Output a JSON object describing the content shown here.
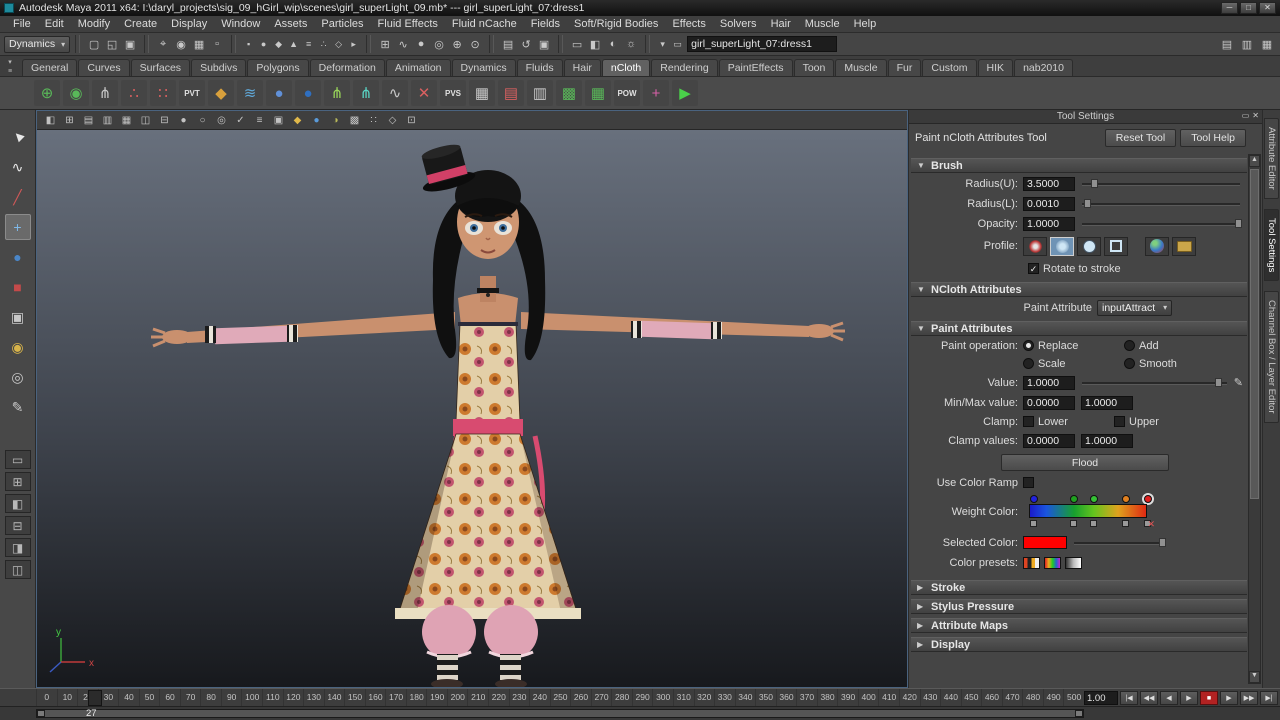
{
  "window": {
    "title": "Autodesk Maya 2011 x64: I:\\daryl_projects\\sig_09_hGirl_wip\\scenes\\girl_superLight_09.mb*  ---  girl_superLight_07:dress1",
    "minimize": "─",
    "maximize": "□",
    "close": "✕"
  },
  "menu_bar": {
    "items": [
      "File",
      "Edit",
      "Modify",
      "Create",
      "Display",
      "Window",
      "Assets",
      "Particles",
      "Fluid Effects",
      "Fluid nCache",
      "Fields",
      "Soft/Rigid Bodies",
      "Effects",
      "Solvers",
      "Hair",
      "Muscle",
      "Help"
    ]
  },
  "status_line": {
    "menu_set": "Dynamics",
    "name_field": "girl_superLight_07:dress1",
    "file_icons": [
      {
        "glyph": "▢",
        "name": "new-scene-icon"
      },
      {
        "glyph": "◱",
        "name": "open-scene-icon"
      },
      {
        "glyph": "▣",
        "name": "save-scene-icon"
      }
    ],
    "select_mode_icons": [
      {
        "glyph": "⌖",
        "name": "select-by-hierarchy-icon"
      },
      {
        "glyph": "◉",
        "name": "select-by-object-icon"
      },
      {
        "glyph": "▦",
        "name": "select-by-component-icon"
      },
      {
        "glyph": "▫",
        "name": "highlight-selection-icon"
      }
    ],
    "mask_icons": [
      {
        "glyph": "▪",
        "name": "selection-mask-icon"
      },
      {
        "glyph": "●",
        "name": "selection-mask-icon"
      },
      {
        "glyph": "◆",
        "name": "selection-mask-icon"
      },
      {
        "glyph": "▲",
        "name": "selection-mask-icon"
      },
      {
        "glyph": "≡",
        "name": "selection-mask-icon"
      },
      {
        "glyph": "∴",
        "name": "selection-mask-icon"
      },
      {
        "glyph": "◇",
        "name": "selection-mask-icon"
      },
      {
        "glyph": "▸",
        "name": "selection-mask-icon"
      }
    ],
    "snap_icons": [
      {
        "glyph": "⊞",
        "name": "snap-to-grid-icon"
      },
      {
        "glyph": "∿",
        "name": "snap-to-curve-icon"
      },
      {
        "glyph": "●",
        "name": "snap-to-point-icon"
      },
      {
        "glyph": "◎",
        "name": "snap-to-projected-center-icon"
      },
      {
        "glyph": "⊕",
        "name": "snap-to-view-plane-icon"
      },
      {
        "glyph": "⊙",
        "name": "make-object-live-icon"
      }
    ],
    "history_icons": [
      {
        "glyph": "▤",
        "name": "input-connections-icon"
      },
      {
        "glyph": "↺",
        "name": "construction-history-icon"
      },
      {
        "glyph": "▣",
        "name": "output-connections-icon"
      }
    ],
    "render_icons": [
      {
        "glyph": "▭",
        "name": "open-render-view-icon"
      },
      {
        "glyph": "◧",
        "name": "render-current-frame-icon"
      },
      {
        "glyph": "◐",
        "name": "ipr-render-icon"
      },
      {
        "glyph": "☼",
        "name": "render-settings-icon"
      }
    ],
    "field_icons": [
      {
        "glyph": "▾",
        "name": "input-line-mode-icon"
      },
      {
        "glyph": "▭",
        "name": "numeric-input-icon"
      }
    ],
    "right_icons": [
      {
        "glyph": "▤",
        "name": "show-attribute-editor-icon"
      },
      {
        "glyph": "▥",
        "name": "show-tool-settings-icon"
      },
      {
        "glyph": "▦",
        "name": "show-channel-box-icon"
      }
    ]
  },
  "shelf": {
    "menu_arrow": "▾",
    "menu_list": "≡",
    "tabs": [
      {
        "label": "General"
      },
      {
        "label": "Curves"
      },
      {
        "label": "Surfaces"
      },
      {
        "label": "Subdivs"
      },
      {
        "label": "Polygons"
      },
      {
        "label": "Deformation"
      },
      {
        "label": "Animation"
      },
      {
        "label": "Dynamics"
      },
      {
        "label": "Fluids"
      },
      {
        "label": "Hair"
      },
      {
        "label": "nCloth",
        "cls": "active"
      },
      {
        "label": "Rendering"
      },
      {
        "label": "PaintEffects"
      },
      {
        "label": "Toon"
      },
      {
        "label": "Muscle"
      },
      {
        "label": "Fur"
      },
      {
        "label": "Custom"
      },
      {
        "label": "HIK"
      },
      {
        "label": "nab2010"
      }
    ],
    "icons": [
      {
        "glyph": "⊕",
        "color": "#59b859",
        "name": "shelf-tool-icon"
      },
      {
        "glyph": "◉",
        "color": "#59b859",
        "name": "shelf-tool-icon"
      },
      {
        "glyph": "⋔",
        "color": "#c8c8c8",
        "name": "shelf-tool-icon"
      },
      {
        "glyph": "∴",
        "color": "#d86060",
        "name": "shelf-tool-icon"
      },
      {
        "glyph": "∷",
        "color": "#d86060",
        "name": "shelf-tool-icon"
      },
      {
        "glyph": "PVT",
        "color": "#e0e0e0",
        "cls": "txt",
        "name": "shelf-tool-icon"
      },
      {
        "glyph": "◆",
        "color": "#d8a03c",
        "name": "shelf-tool-icon"
      },
      {
        "glyph": "≋",
        "color": "#60a8d8",
        "name": "shelf-tool-icon"
      },
      {
        "glyph": "●",
        "color": "#6090d8",
        "name": "shelf-tool-icon"
      },
      {
        "glyph": "●",
        "color": "#2f6fc0",
        "name": "shelf-tool-icon"
      },
      {
        "glyph": "⋔",
        "color": "#9ad85a",
        "name": "shelf-tool-icon"
      },
      {
        "glyph": "⋔",
        "color": "#5ad8c8",
        "name": "shelf-tool-icon"
      },
      {
        "glyph": "∿",
        "color": "#c8c8c8",
        "name": "shelf-tool-icon"
      },
      {
        "glyph": "✕",
        "color": "#d86060",
        "name": "shelf-tool-icon"
      },
      {
        "glyph": "PVS",
        "color": "#e0e0e0",
        "cls": "txt",
        "name": "shelf-tool-icon"
      },
      {
        "glyph": "▦",
        "color": "#c8c8c8",
        "name": "shelf-tool-icon"
      },
      {
        "glyph": "▤",
        "color": "#d86060",
        "name": "shelf-tool-icon"
      },
      {
        "glyph": "▥",
        "color": "#c8c8c8",
        "name": "shelf-tool-icon"
      },
      {
        "glyph": "▩",
        "color": "#59b859",
        "name": "shelf-tool-icon"
      },
      {
        "glyph": "▦",
        "color": "#59b859",
        "name": "shelf-tool-icon"
      },
      {
        "glyph": "POW",
        "color": "#e0e0e0",
        "cls": "txt",
        "name": "shelf-tool-icon"
      },
      {
        "glyph": "+",
        "color": "#d860a8",
        "name": "shelf-tool-icon"
      },
      {
        "glyph": "▶",
        "color": "#4ad04a",
        "name": "play-blast-icon"
      }
    ]
  },
  "toolbox": {
    "tools": [
      {
        "glyph": "►",
        "name": "select-tool-icon",
        "cls": "rot",
        "color": "#e8e8e8"
      },
      {
        "glyph": "∿",
        "name": "lasso-select-tool-icon",
        "color": "#e8e8e8"
      },
      {
        "glyph": "╱",
        "name": "paint-select-tool-icon",
        "color": "#d05858"
      },
      {
        "glyph": "+",
        "name": "move-tool-icon",
        "cls": "active",
        "color": "#7fb8e8"
      },
      {
        "glyph": "●",
        "name": "rotate-tool-icon",
        "color": "#4a86c8"
      },
      {
        "glyph": "■",
        "name": "scale-tool-icon",
        "color": "#c44a4a"
      },
      {
        "glyph": "▣",
        "name": "universal-manipulator-icon",
        "color": "#c8c8c8"
      },
      {
        "glyph": "◉",
        "name": "soft-modification-tool-icon",
        "color": "#d8b44a"
      },
      {
        "glyph": "◎",
        "name": "show-manipulator-tool-icon",
        "color": "#c8c8c8"
      },
      {
        "glyph": "✎",
        "name": "last-tool-used-icon",
        "color": "#c8c8c8"
      }
    ],
    "layouts": [
      {
        "glyph": "▭",
        "name": "single-pane-layout-button"
      },
      {
        "glyph": "⊞",
        "name": "four-pane-layout-button"
      },
      {
        "glyph": "◧",
        "name": "persp-outliner-layout-button"
      },
      {
        "glyph": "⊟",
        "name": "persp-graph-layout-button"
      },
      {
        "glyph": "◨",
        "name": "hypershade-persp-layout-button"
      },
      {
        "glyph": "◫",
        "name": "persp-uv-layout-button"
      }
    ]
  },
  "viewport": {
    "bar_icons": [
      {
        "glyph": "◧",
        "name": "panel-toolbar-icon"
      },
      {
        "glyph": "⊞",
        "name": "panel-toolbar-icon"
      },
      {
        "glyph": "▤",
        "name": "panel-toolbar-icon"
      },
      {
        "glyph": "▥",
        "name": "panel-toolbar-icon"
      },
      {
        "glyph": "▦",
        "name": "panel-toolbar-icon"
      },
      {
        "glyph": "◫",
        "name": "panel-toolbar-icon"
      },
      {
        "glyph": "⊟",
        "name": "panel-toolbar-icon"
      },
      {
        "glyph": "●",
        "name": "panel-toolbar-icon"
      },
      {
        "glyph": "○",
        "name": "panel-toolbar-icon"
      },
      {
        "glyph": "◎",
        "name": "panel-toolbar-icon"
      },
      {
        "glyph": "✓",
        "name": "panel-toolbar-icon"
      },
      {
        "glyph": "≡",
        "name": "panel-toolbar-icon"
      },
      {
        "glyph": "▣",
        "name": "panel-toolbar-icon"
      },
      {
        "glyph": "◆",
        "color": "#e0b84a",
        "name": "panel-toolbar-icon"
      },
      {
        "glyph": "●",
        "color": "#5a9ad8",
        "name": "panel-toolbar-icon"
      },
      {
        "glyph": "◑",
        "color": "#b8b85a",
        "name": "panel-toolbar-icon"
      },
      {
        "glyph": "▩",
        "name": "panel-toolbar-icon"
      },
      {
        "glyph": "∷",
        "name": "panel-toolbar-icon"
      },
      {
        "glyph": "◇",
        "name": "panel-toolbar-icon"
      },
      {
        "glyph": "⊡",
        "name": "panel-toolbar-icon"
      }
    ],
    "axis_y": "y",
    "axis_x": "x"
  },
  "tool_settings": {
    "panel_title": "Tool Settings",
    "tool_name": "Paint nCloth Attributes Tool",
    "reset_label": "Reset Tool",
    "help_label": "Tool Help",
    "brush": {
      "header": "Brush",
      "radius_u_label": "Radius(U):",
      "radius_u": "3.5000",
      "radius_l_label": "Radius(L):",
      "radius_l": "0.0010",
      "opacity_label": "Opacity:",
      "opacity": "1.0000",
      "profile_label": "Profile:",
      "rotate_label": "Rotate to stroke",
      "rotate_check": "✓"
    },
    "ncloth": {
      "header": "NCloth Attributes",
      "paint_attribute_label": "Paint Attribute",
      "paint_attribute_value": "inputAttract"
    },
    "paint": {
      "header": "Paint Attributes",
      "operation_label": "Paint operation:",
      "op_replace": "Replace",
      "op_add": "Add",
      "op_scale": "Scale",
      "op_smooth": "Smooth",
      "value_label": "Value:",
      "value": "1.0000",
      "minmax_label": "Min/Max value:",
      "min": "0.0000",
      "max": "1.0000",
      "clamp_label": "Clamp:",
      "clamp_lower": "Lower",
      "clamp_upper": "Upper",
      "clamp_values_label": "Clamp values:",
      "clamp_min": "0.0000",
      "clamp_max": "1.0000",
      "flood_label": "Flood",
      "use_color_ramp_label": "Use Color Ramp",
      "weight_color_label": "Weight Color:",
      "selected_color_label": "Selected Color:",
      "selected_color": "#ff0000",
      "color_presets_label": "Color presets:",
      "ramp_stops": [
        {
          "left": "1%",
          "bg": "#2222dd"
        },
        {
          "left": "34%",
          "bg": "#20a020"
        },
        {
          "left": "50%",
          "bg": "#35c035"
        },
        {
          "left": "76%",
          "bg": "#e08020"
        },
        {
          "left": "94%",
          "bg": "#e02020",
          "cls": "sel"
        }
      ],
      "ramp_keys": [
        {
          "left": "1%"
        },
        {
          "left": "34%"
        },
        {
          "left": "50%"
        },
        {
          "left": "76%"
        },
        {
          "left": "94%"
        }
      ]
    },
    "collapsed_sections": [
      {
        "label": "Stroke"
      },
      {
        "label": "Stylus Pressure"
      },
      {
        "label": "Attribute Maps"
      },
      {
        "label": "Display"
      }
    ]
  },
  "side_tabs": [
    {
      "label": "Attribute Editor",
      "name": "tab-attribute-editor"
    },
    {
      "label": "Tool Settings",
      "name": "tab-tool-settings",
      "cls": "active"
    },
    {
      "label": "Channel Box / Layer Editor",
      "name": "tab-channel-box"
    }
  ],
  "timeline": {
    "ticks": [
      "0",
      "10",
      "20",
      "30",
      "40",
      "50",
      "60",
      "70",
      "80",
      "90",
      "100",
      "110",
      "120",
      "130",
      "140",
      "150",
      "160",
      "170",
      "180",
      "190",
      "200",
      "210",
      "220",
      "230",
      "240",
      "250",
      "260",
      "270",
      "280",
      "290",
      "300",
      "310",
      "320",
      "330",
      "340",
      "350",
      "360",
      "370",
      "380",
      "390",
      "400",
      "410",
      "420",
      "430",
      "440",
      "450",
      "460",
      "470",
      "480",
      "490",
      "500"
    ],
    "current_frame": "27",
    "speed": "1.00",
    "playback": [
      {
        "glyph": "|◀",
        "name": "go-to-start-button"
      },
      {
        "glyph": "◀◀",
        "name": "step-back-key-button"
      },
      {
        "glyph": "◀",
        "name": "step-back-frame-button"
      },
      {
        "glyph": "▶",
        "name": "play-backwards-button"
      },
      {
        "glyph": "■",
        "name": "stop-button",
        "cls": "red"
      },
      {
        "glyph": "▶",
        "name": "play-forwards-button"
      },
      {
        "glyph": "▶▶",
        "name": "step-forward-key-button"
      },
      {
        "glyph": "▶|",
        "name": "go-to-end-button"
      }
    ]
  }
}
